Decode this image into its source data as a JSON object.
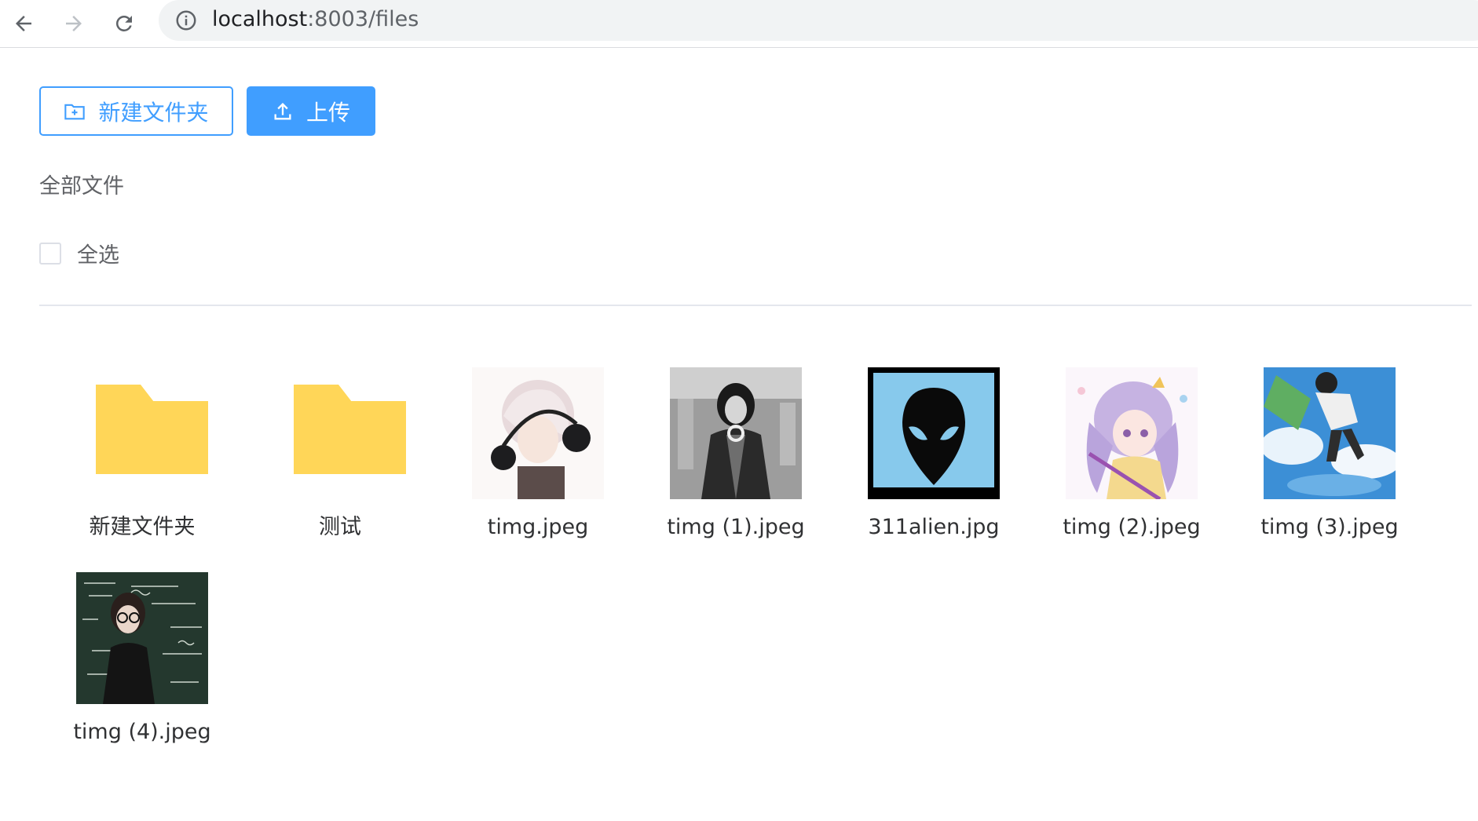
{
  "browser": {
    "url_host": "localhost",
    "url_rest": ":8003/files",
    "icons": [
      "back-arrow-icon",
      "forward-arrow-icon",
      "reload-icon",
      "info-icon"
    ]
  },
  "toolbar": {
    "new_folder_label": "新建文件夹",
    "upload_label": "上传",
    "accent_color": "#409eff"
  },
  "breadcrumb": "全部文件",
  "select_all_label": "全选",
  "files": [
    {
      "name": "新建文件夹",
      "kind": "folder"
    },
    {
      "name": "测试",
      "kind": "folder"
    },
    {
      "name": "timg.jpeg",
      "kind": "image"
    },
    {
      "name": "timg (1).jpeg",
      "kind": "image"
    },
    {
      "name": "311alien.jpg",
      "kind": "image"
    },
    {
      "name": "timg (2).jpeg",
      "kind": "image"
    },
    {
      "name": "timg (3).jpeg",
      "kind": "image"
    },
    {
      "name": "timg (4).jpeg",
      "kind": "image"
    }
  ],
  "colors": {
    "folder": "#ffd658",
    "alien_bg": "#87c9ec"
  }
}
